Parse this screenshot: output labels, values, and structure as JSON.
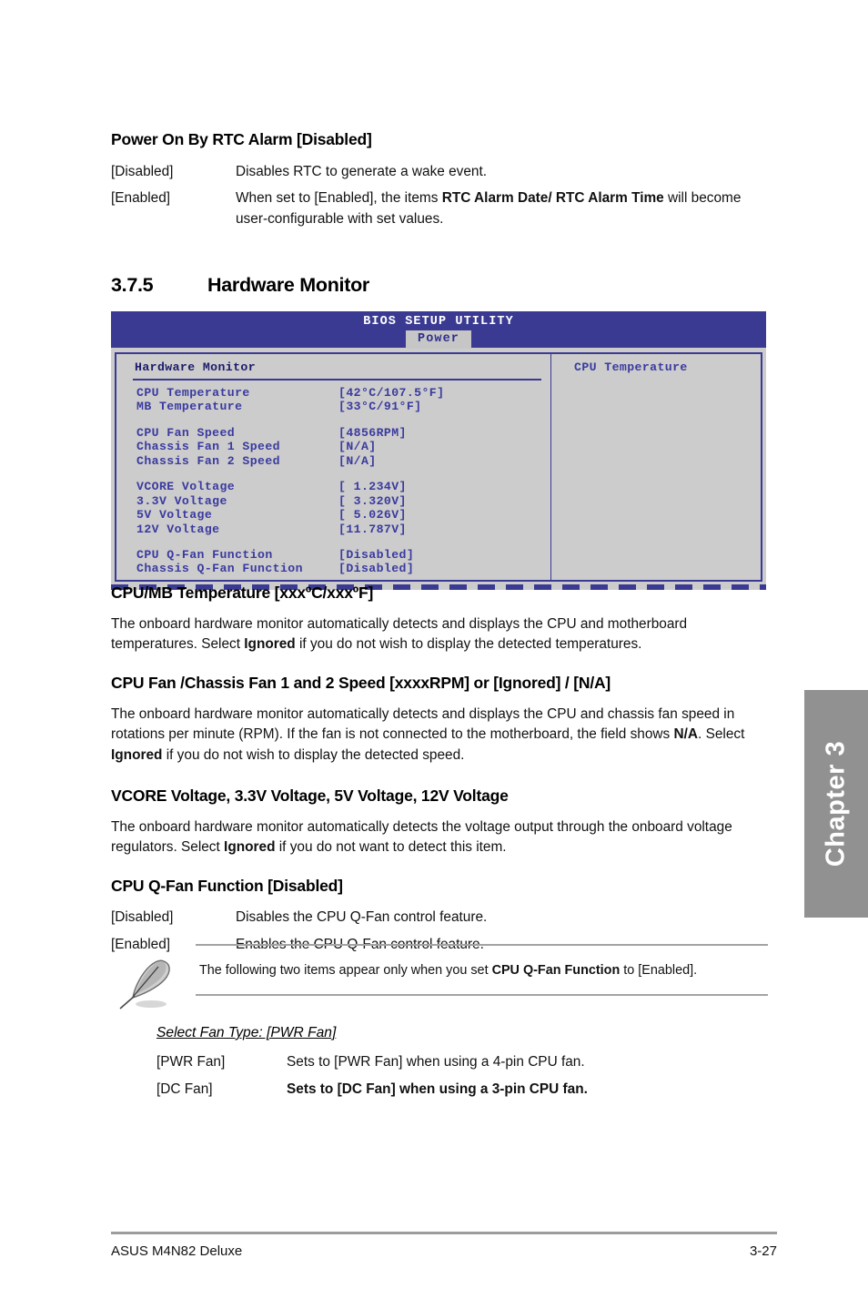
{
  "sections": {
    "rtc": {
      "heading": "Power On By RTC Alarm [Disabled]",
      "rows": [
        {
          "key": "[Disabled]",
          "text": "Disables RTC to generate a wake event."
        },
        {
          "key": "[Enabled]",
          "pre": "When set to [Enabled], the items ",
          "bold": "RTC Alarm Date/ RTC Alarm Time",
          "post": " will become user-configurable with set values."
        }
      ]
    },
    "hardware_monitor": {
      "number": "3.7.5",
      "title": "Hardware Monitor"
    },
    "cpu_mb_temperature": {
      "heading": "CPU/MB Temperature [xxxºC/xxxºF]",
      "pre": "The onboard hardware monitor automatically detects and displays the CPU and motherboard temperatures. Select ",
      "bold": "Ignored",
      "post": " if you do not wish to display the detected temperatures."
    },
    "fan_speed": {
      "heading": "CPU Fan /Chassis Fan 1 and 2 Speed [xxxxRPM] or [Ignored] / [N/A]",
      "p1": "The onboard hardware monitor automatically detects and displays the CPU and chassis fan speed in rotations per minute (RPM). If the fan is not connected to the motherboard, the field shows ",
      "b1": "N/A",
      "p2": ". Select ",
      "b2": "Ignored",
      "p3": " if you do not wish to display the detected speed."
    },
    "voltage": {
      "heading": "VCORE Voltage, 3.3V Voltage, 5V Voltage, 12V Voltage",
      "pre": "The onboard hardware monitor automatically detects the voltage output through the onboard voltage regulators. Select ",
      "bold": "Ignored",
      "post": " if you do not want to detect this item."
    },
    "cpu_qfan": {
      "heading": "CPU Q-Fan Function [Disabled]",
      "rows": [
        {
          "key": "[Disabled]",
          "text": "Disables the CPU Q-Fan control feature."
        },
        {
          "key": "[Enabled]",
          "text": "Enables the CPU Q-Fan control feature."
        }
      ]
    },
    "note": {
      "icon": "note-pencil-icon",
      "pre": "The following two items appear only when you set ",
      "bold": "CPU Q-Fan Function",
      "post": " to [Enabled]."
    },
    "select_fan_type": {
      "title": "Select Fan Type: [PWR Fan]",
      "rows": [
        {
          "key": "[PWR Fan]",
          "text": "Sets to [PWR Fan] when using a 4-pin CPU fan."
        },
        {
          "key": "[DC Fan]",
          "text": "Sets to [DC Fan] when using a 3-pin CPU fan."
        }
      ]
    }
  },
  "bios": {
    "title": "BIOS SETUP UTILITY",
    "tab": "Power",
    "panel_title": "Hardware Monitor",
    "items": [
      {
        "label": "CPU Temperature",
        "value": "[42°C/107.5°F]"
      },
      {
        "label": "MB Temperature",
        "value": "[33°C/91°F]"
      },
      {
        "label": "",
        "value": ""
      },
      {
        "label": "CPU Fan Speed",
        "value": "[4856RPM]"
      },
      {
        "label": "Chassis Fan 1 Speed",
        "value": "[N/A]"
      },
      {
        "label": "Chassis Fan 2 Speed",
        "value": "[N/A]"
      },
      {
        "label": "",
        "value": ""
      },
      {
        "label": "VCORE Voltage",
        "value": "[ 1.234V]"
      },
      {
        "label": "3.3V Voltage",
        "value": "[ 3.320V]"
      },
      {
        "label": "5V Voltage",
        "value": "[ 5.026V]"
      },
      {
        "label": "12V Voltage",
        "value": "[11.787V]"
      },
      {
        "label": "",
        "value": ""
      },
      {
        "label": "CPU Q-Fan Function",
        "value": "[Disabled]"
      },
      {
        "label": "Chassis Q-Fan Function",
        "value": "[Disabled]"
      }
    ],
    "help_text": "CPU Temperature",
    "colors": {
      "header_bg": "#3a3a93",
      "body_bg": "#cccccc",
      "text": "#3a3aa0",
      "tab_bg": "#c6c6c6"
    }
  },
  "chapter_tab": {
    "label": "Chapter 3",
    "color": "#919191"
  },
  "footer": {
    "left": "ASUS M4N82 Deluxe",
    "right": "3-27"
  }
}
